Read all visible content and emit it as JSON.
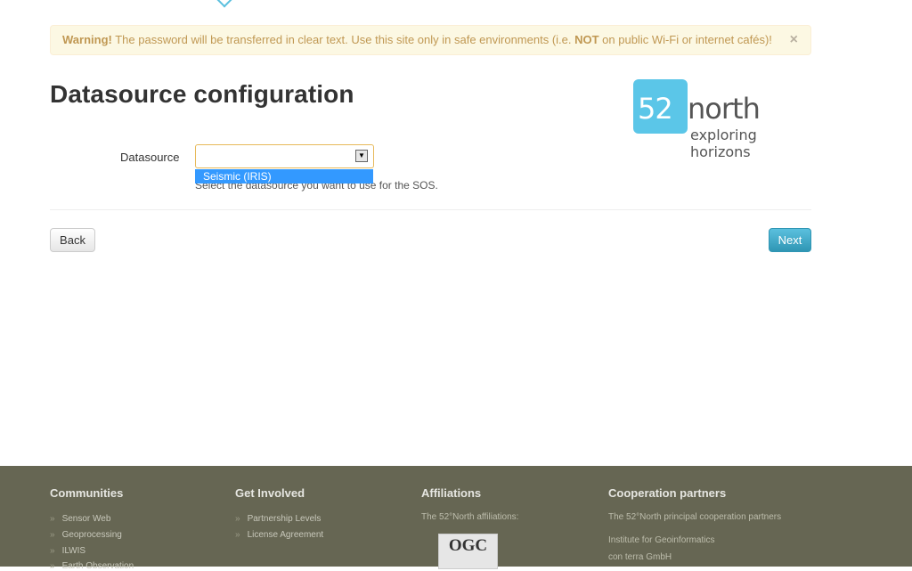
{
  "alert": {
    "label": "Warning!",
    "text_before": " The password will be transferred in clear text. Use this site only in safe environments (i.e. ",
    "emphasis": "NOT",
    "text_after": " on public Wi-Fi or internet cafés)!",
    "close": "×"
  },
  "page": {
    "title": "Datasource configuration"
  },
  "logo": {
    "number": "52",
    "word": "north",
    "tagline": "exploring horizons"
  },
  "form": {
    "label": "Datasource",
    "selected_value": "",
    "dropdown_option": "Seismic (IRIS)",
    "help": "Select the datasource you want to use for the SOS."
  },
  "buttons": {
    "back": "Back",
    "next": "Next"
  },
  "footer": {
    "communities": {
      "title": "Communities",
      "items": [
        "Sensor Web",
        "Geoprocessing",
        "ILWIS",
        "Earth Observation"
      ]
    },
    "involved": {
      "title": "Get Involved",
      "items": [
        "Partnership Levels",
        "License Agreement"
      ]
    },
    "affiliations": {
      "title": "Affiliations",
      "text": "The 52°North affiliations:",
      "badge": "OGC"
    },
    "partners": {
      "title": "Cooperation partners",
      "text": "The 52°North principal cooperation partners",
      "items": [
        "Institute for Geoinformatics",
        "con terra GmbH"
      ]
    }
  },
  "colors": {
    "accent": "#5bc0de",
    "warning_bg": "#fcf8e3",
    "footer_bg": "#666653"
  }
}
